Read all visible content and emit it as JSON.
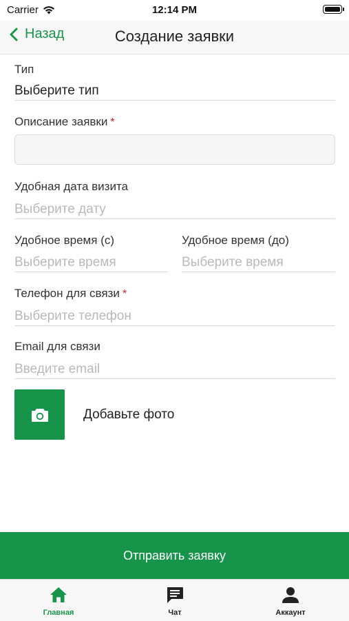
{
  "status_bar": {
    "carrier": "Carrier",
    "time": "12:14 PM"
  },
  "navbar": {
    "back_label": "Назад",
    "title": "Создание заявки"
  },
  "form": {
    "type": {
      "label": "Тип",
      "value": "Выберите тип"
    },
    "description": {
      "label": "Описание заявки",
      "required_mark": "*",
      "value": ""
    },
    "visit_date": {
      "label": "Удобная дата визита",
      "placeholder": "Выберите дату"
    },
    "time_from": {
      "label": "Удобное время (с)",
      "placeholder": "Выберите время"
    },
    "time_to": {
      "label": "Удобное время (до)",
      "placeholder": "Выберите время"
    },
    "phone": {
      "label": "Телефон для связи",
      "required_mark": "*",
      "placeholder": "Выберите телефон"
    },
    "email": {
      "label": "Email для связи",
      "placeholder": "Введите email"
    },
    "photo": {
      "label": "Добавьте фото",
      "icon": "camera-icon"
    }
  },
  "submit_label": "Отправить заявку",
  "tabbar": {
    "items": [
      {
        "label": "Главная",
        "icon": "home-icon",
        "active": true
      },
      {
        "label": "Чат",
        "icon": "chat-icon",
        "active": false
      },
      {
        "label": "Аккаунт",
        "icon": "account-icon",
        "active": false
      }
    ]
  },
  "colors": {
    "accent": "#16954a",
    "required": "#d61f1f",
    "placeholder": "#b9b9b9"
  }
}
